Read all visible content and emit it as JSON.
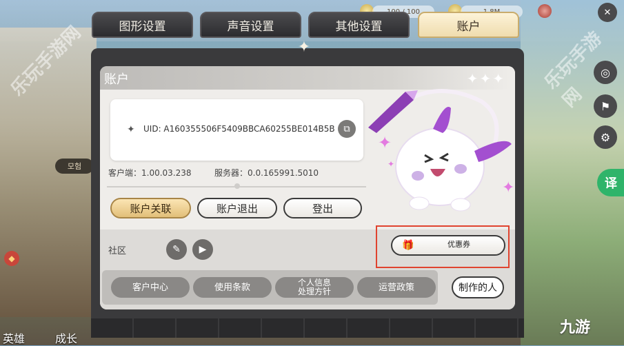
{
  "tabs": [
    {
      "label": "图形设置"
    },
    {
      "label": "声音设置"
    },
    {
      "label": "其他设置"
    },
    {
      "label": "账户"
    }
  ],
  "panel": {
    "title": "账户",
    "uid": "UID: A160355506F5409BBCA60255BE014B5B",
    "client_version": "客户端：1.00.03.238",
    "server_version": "服务器：0.0.165991.5010"
  },
  "account_buttons": {
    "link": "账户关联",
    "logout": "账户退出",
    "login": "登出"
  },
  "community": {
    "label": "社区",
    "coupon": "优惠券"
  },
  "links": [
    {
      "label": "客户中心"
    },
    {
      "label": "使用条款"
    },
    {
      "label": "个人信息\n处理方针"
    },
    {
      "label": "运营政策"
    }
  ],
  "credits_label": "制作的人",
  "hud": {
    "stamina": "100 / 100",
    "gold": "1.8M"
  },
  "bottom_nav": {
    "heroes": "英雄",
    "growth": "成长"
  },
  "side": {
    "translate": "译",
    "left_label": "모험"
  },
  "watermark": {
    "site": "乐玩手游网",
    "brand": "九游"
  }
}
